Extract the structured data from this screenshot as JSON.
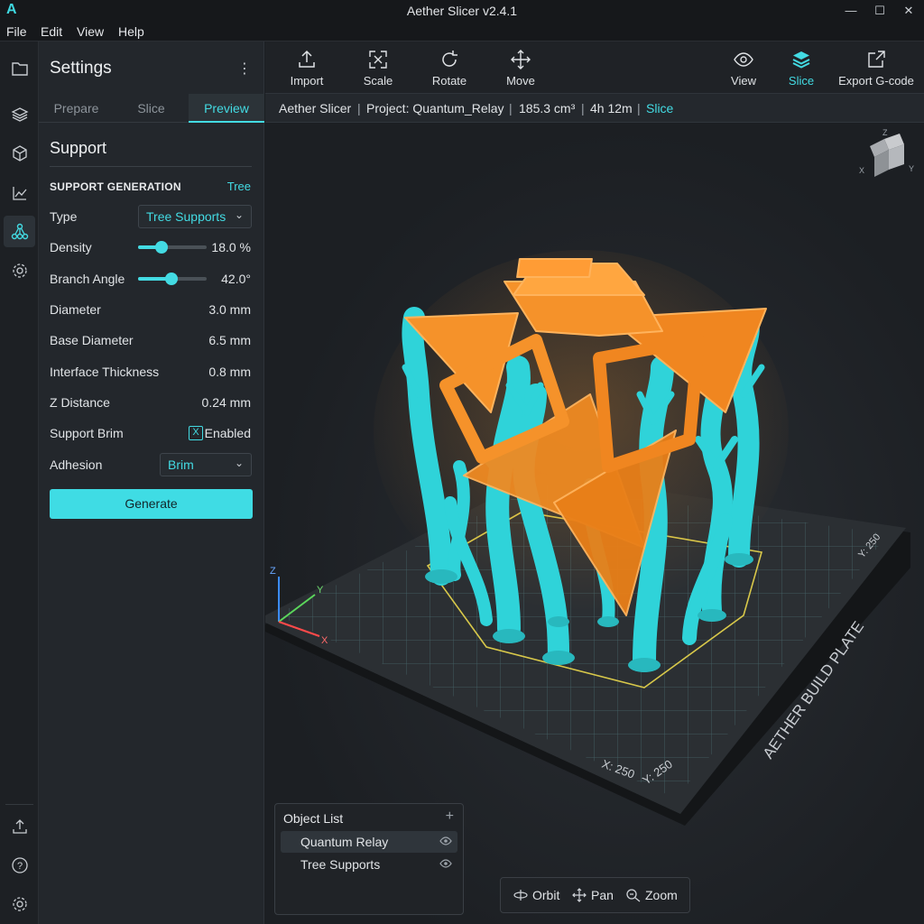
{
  "app": {
    "logo": "A",
    "title": "Aether Slicer v2.4.1",
    "window_controls": [
      "minimize-icon",
      "maximize-icon",
      "close-icon"
    ]
  },
  "menu": [
    "File",
    "Edit",
    "View",
    "Help"
  ],
  "rail": {
    "top_icons": [
      "folder-icon",
      "layers-icon",
      "cube-icon",
      "chart-icon",
      "support-tree-icon",
      "gear-icon"
    ],
    "active_index": 4,
    "bottom_icons": [
      "upload-icon",
      "help-icon",
      "settings-icon"
    ]
  },
  "settings": {
    "title": "Settings",
    "tabs": [
      "Prepare",
      "Slice",
      "Preview"
    ],
    "active_tab": 2,
    "section": "Support",
    "generation_label": "SUPPORT GENERATION",
    "generation_value": "Tree",
    "rows": {
      "type": {
        "label": "Type",
        "value": "Tree Supports"
      },
      "density": {
        "label": "Density",
        "value": "18.0 %",
        "fraction": 0.34
      },
      "branch_angle": {
        "label": "Branch Angle",
        "value": "42.0°",
        "fraction": 0.49
      },
      "diameter": {
        "label": "Diameter",
        "value": "3.0 mm"
      },
      "base_diameter": {
        "label": "Base Diameter",
        "value": "6.5 mm"
      },
      "interface_thickness": {
        "label": "Interface Thickness",
        "value": "0.8 mm"
      },
      "z_distance": {
        "label": "Z Distance",
        "value": "0.24 mm"
      },
      "support_brim": {
        "label": "Support Brim",
        "value": "Enabled",
        "checked": true
      },
      "adhesion": {
        "label": "Adhesion",
        "value": "Brim"
      }
    },
    "generate_label": "Generate"
  },
  "toolbar": {
    "left": [
      {
        "label": "Import",
        "icon": "import-icon"
      },
      {
        "label": "Scale",
        "icon": "scale-icon"
      },
      {
        "label": "Rotate",
        "icon": "rotate-icon"
      },
      {
        "label": "Move",
        "icon": "move-icon"
      }
    ],
    "right": [
      {
        "label": "View",
        "icon": "eye-icon"
      },
      {
        "label": "Slice",
        "icon": "layers-icon",
        "active": true
      },
      {
        "label": "Export G-code",
        "icon": "export-icon"
      }
    ]
  },
  "status": {
    "app": "Aether Slicer",
    "project": "Project: Quantum_Relay",
    "volume": "185.3 cm³",
    "time": "4h 12m",
    "mode": "Slice",
    "separator": "|"
  },
  "viewport": {
    "plate_label": "AETHER BUILD PLATE",
    "plate_x": "X: 250",
    "plate_y": "Y: 250",
    "plate_y_top": "Y: 250",
    "axes": {
      "x": "X",
      "y": "Y",
      "z": "Z"
    },
    "viewcube": {
      "z": "Z",
      "x": "X",
      "y": "Y"
    },
    "colors": {
      "model": "#f5922a",
      "support": "#2fd3d9",
      "plate": "#2b2f33",
      "grid": "#4a6b70",
      "brim_outline": "#d8c84a"
    }
  },
  "object_list": {
    "title": "Object List",
    "add_icon": "plus-icon",
    "items": [
      {
        "name": "Quantum Relay",
        "selected": true
      },
      {
        "name": "Tree Supports",
        "selected": false
      }
    ]
  },
  "nav": [
    {
      "label": "Orbit",
      "icon": "orbit-icon"
    },
    {
      "label": "Pan",
      "icon": "pan-icon"
    },
    {
      "label": "Zoom",
      "icon": "zoom-icon"
    }
  ],
  "accent": "#43dbe3"
}
